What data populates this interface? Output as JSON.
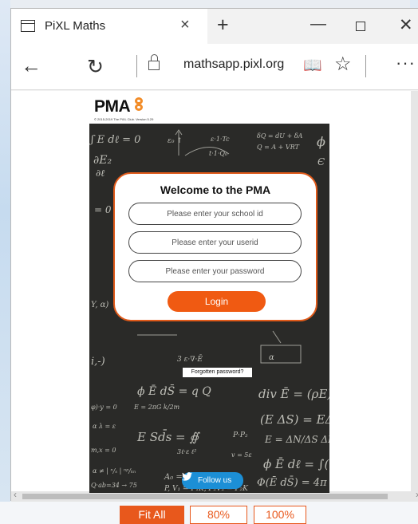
{
  "browser": {
    "tab_title": "PiXL Maths",
    "tab_close": "×",
    "new_tab": "+",
    "minimize": "—",
    "close": "✕",
    "back": "←",
    "refresh": "↻",
    "url_host": "mathsapp.pixl.org",
    "reading_view": "📖",
    "favorite": "☆",
    "more": "···"
  },
  "app": {
    "logo_text": "PMA",
    "copyright": "© 2015-2019 The PiXL Club. Version 5.29",
    "login": {
      "heading": "Welcome to the PMA",
      "school_id_placeholder": "Please enter your school id",
      "userid_placeholder": "Please enter your userid",
      "password_placeholder": "Please enter your password",
      "button": "Login"
    },
    "forgot": "Forgotten password?",
    "follow": "Follow us"
  },
  "zoom": {
    "options": [
      "Fit All",
      "80%",
      "100%"
    ],
    "selected": "Fit All"
  },
  "colors": {
    "accent_orange": "#f05a12",
    "board": "#2a2a28",
    "twitter_blue": "#1c8fd6"
  }
}
